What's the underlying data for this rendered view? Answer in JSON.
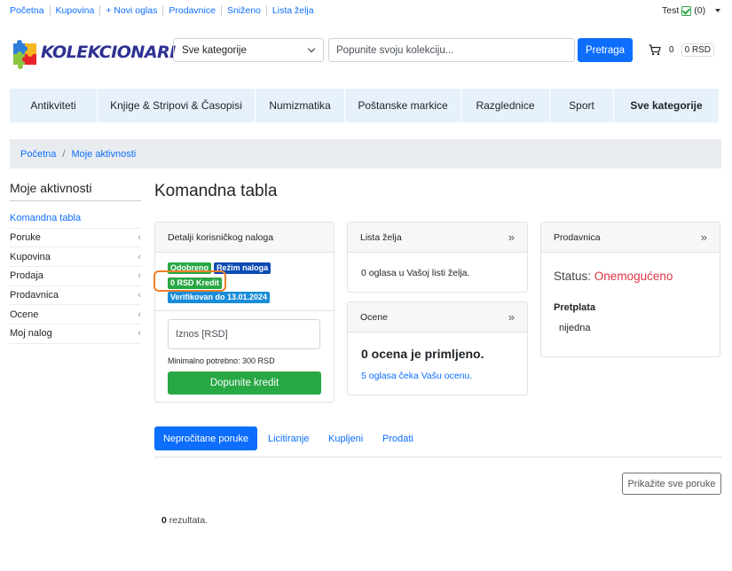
{
  "topbar": {
    "links": [
      "Početna",
      "Kupovina",
      "+ Novi oglas",
      "Prodavnice",
      "Sniženo",
      "Lista želja"
    ],
    "user_name": "Test",
    "user_count": "(0)"
  },
  "header": {
    "logo_text": "KOLEKCIONARI",
    "category_select": "Sve kategorije",
    "search_placeholder": "Popunite svoju kolekciju...",
    "search_button": "Pretraga",
    "cart_count": "0",
    "cart_total": "0 RSD"
  },
  "nav": {
    "items": [
      "Antikviteti",
      "Knjige & Stripovi & Časopisi",
      "Numizmatika",
      "Poštanske markice",
      "Razglednice",
      "Sport",
      "Sve kategorije"
    ]
  },
  "breadcrumb": {
    "home": "Početna",
    "separator": "/",
    "current": "Moje aktivnosti"
  },
  "sidebar": {
    "title": "Moje aktivnosti",
    "items": [
      {
        "label": "Komandna tabla",
        "active": true
      },
      {
        "label": "Poruke"
      },
      {
        "label": "Kupovina"
      },
      {
        "label": "Prodaja"
      },
      {
        "label": "Prodavnica"
      },
      {
        "label": "Ocene"
      },
      {
        "label": "Moj nalog"
      }
    ]
  },
  "main": {
    "title": "Komandna tabla",
    "account_card": {
      "header": "Detalji korisničkog naloga",
      "badge_approved": "Odobreno",
      "badge_mode": "Režim naloga",
      "badge_credit": "0 RSD Kredit",
      "badge_verified": "Verifikovan do 13.01.2024",
      "amount_placeholder": "Iznos [RSD]",
      "min_required": "Minimalno potrebno: 300 RSD",
      "topup_button": "Dopunite kredit"
    },
    "wishlist_card": {
      "header": "Lista želja",
      "text": "0 oglasa u Vašoj listi želja."
    },
    "ratings_card": {
      "header": "Ocene",
      "headline": "0 ocena je primljeno.",
      "link": "5 oglasa čeka Vašu ocenu."
    },
    "store_card": {
      "header": "Prodavnica",
      "status_label": "Status:",
      "status_value": "Onemogućeno",
      "subscription_label": "Pretplata",
      "subscription_value": "nijedna"
    },
    "tabs": [
      "Nepročitane poruke",
      "Licitiranje",
      "Kupljeni",
      "Prodati"
    ],
    "show_all_button": "Prikažite sve poruke",
    "results_count": "0",
    "results_label": "rezultata."
  },
  "colors": {
    "primary": "#0d6efd",
    "success": "#28a745",
    "danger": "#dc3545",
    "highlight": "#f07f2a"
  }
}
